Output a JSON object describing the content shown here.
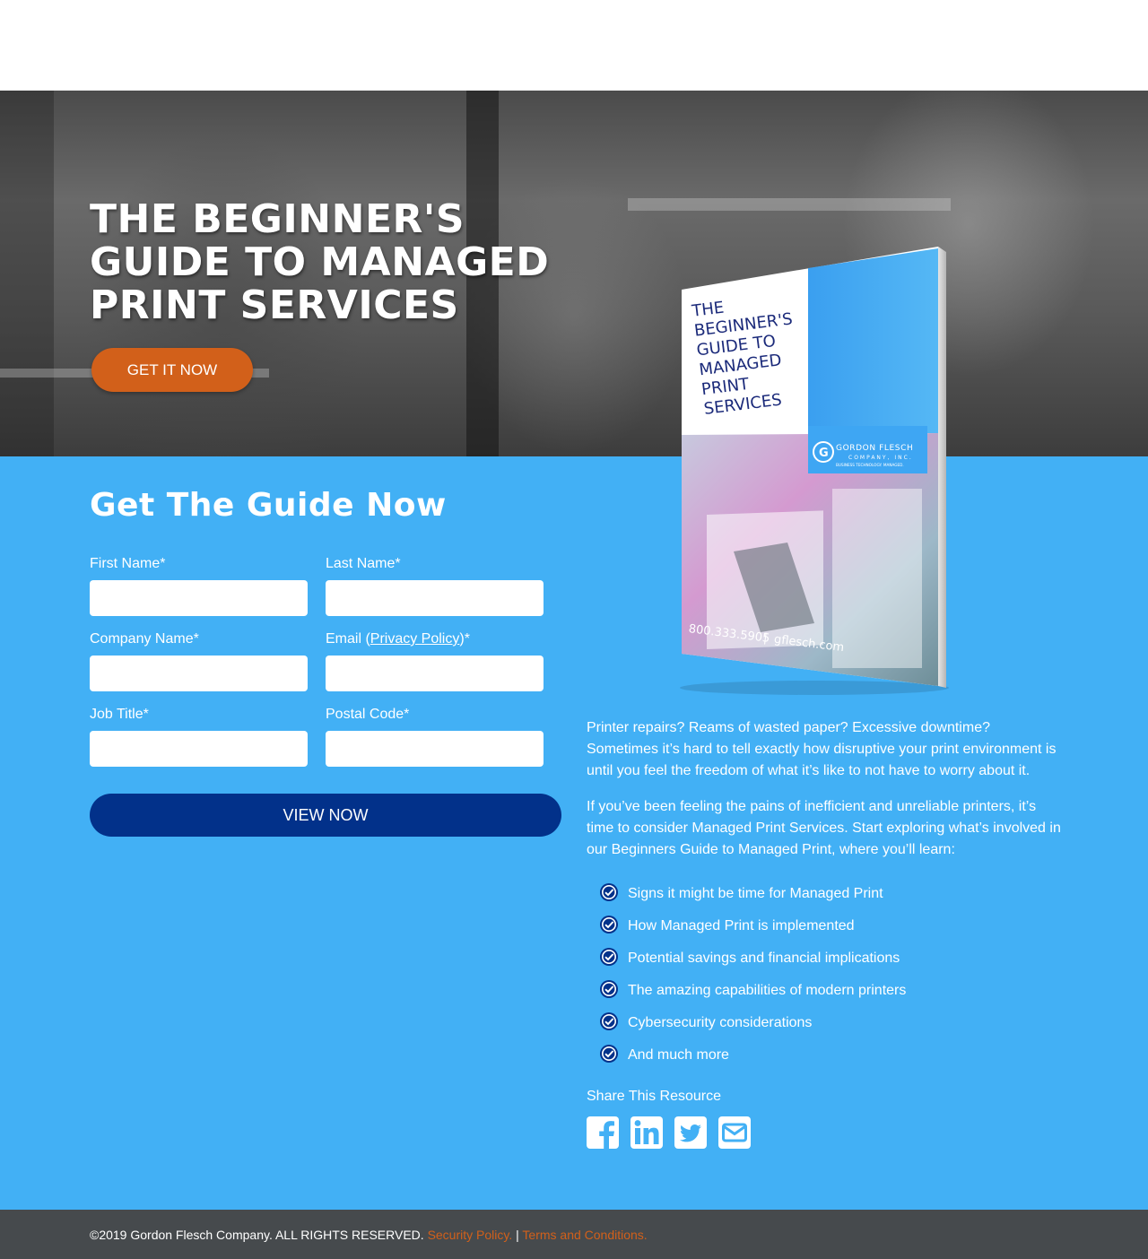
{
  "hero": {
    "title": "THE BEGINNER'S GUIDE TO MANAGED PRINT SERVICES",
    "cta_label": "GET IT NOW"
  },
  "book": {
    "title_lines": [
      "THE",
      "BEGINNER'S",
      "GUIDE TO",
      "MANAGED",
      "PRINT",
      "SERVICES"
    ],
    "brand_name": "GORDON FLESCH",
    "brand_sub": "COMPANY, INC.",
    "brand_tagline": "BUSINESS TECHNOLOGY. MANAGED.",
    "phone": "800.333.5905",
    "sep": "|",
    "website": "gflesch.com"
  },
  "form": {
    "title": "Get The Guide Now",
    "first_name_label": "First Name*",
    "last_name_label": "Last Name*",
    "company_label": "Company Name*",
    "email_label_prefix": "Email (",
    "email_label_link": "Privacy Policy",
    "email_label_suffix": ")*",
    "job_title_label": "Job Title*",
    "postal_label": "Postal Code*",
    "submit_label": "VIEW NOW"
  },
  "content": {
    "para1": "Printer repairs? Reams of wasted paper? Excessive downtime? Sometimes it’s hard to tell exactly how disruptive your print environment is until you feel the freedom of what it’s like to not have to worry about it.",
    "para2": "If you’ve been feeling the pains of inefficient and unreliable printers, it’s time to consider Managed Print Services. Start exploring what’s involved in our Beginners Guide to Managed Print, where you’ll learn:",
    "bullets": [
      "Signs it might be time for Managed Print",
      "How Managed Print is implemented",
      "Potential savings and financial implications",
      "The amazing capabilities of modern printers",
      "Cybersecurity considerations",
      "And much more"
    ],
    "share_label": "Share This Resource",
    "social_icons": [
      "facebook-icon",
      "linkedin-icon",
      "twitter-icon",
      "email-icon"
    ]
  },
  "footer": {
    "copyright": "©2019 Gordon Flesch Company. ALL RIGHTS RESERVED.",
    "security_link": "Security Policy.",
    "separator": "|",
    "terms_link": "Terms and Conditions."
  },
  "colors": {
    "accent_orange": "#d2601a",
    "main_blue": "#42b0f5",
    "button_navy": "#02318a",
    "footer_gray": "#464a4d"
  }
}
